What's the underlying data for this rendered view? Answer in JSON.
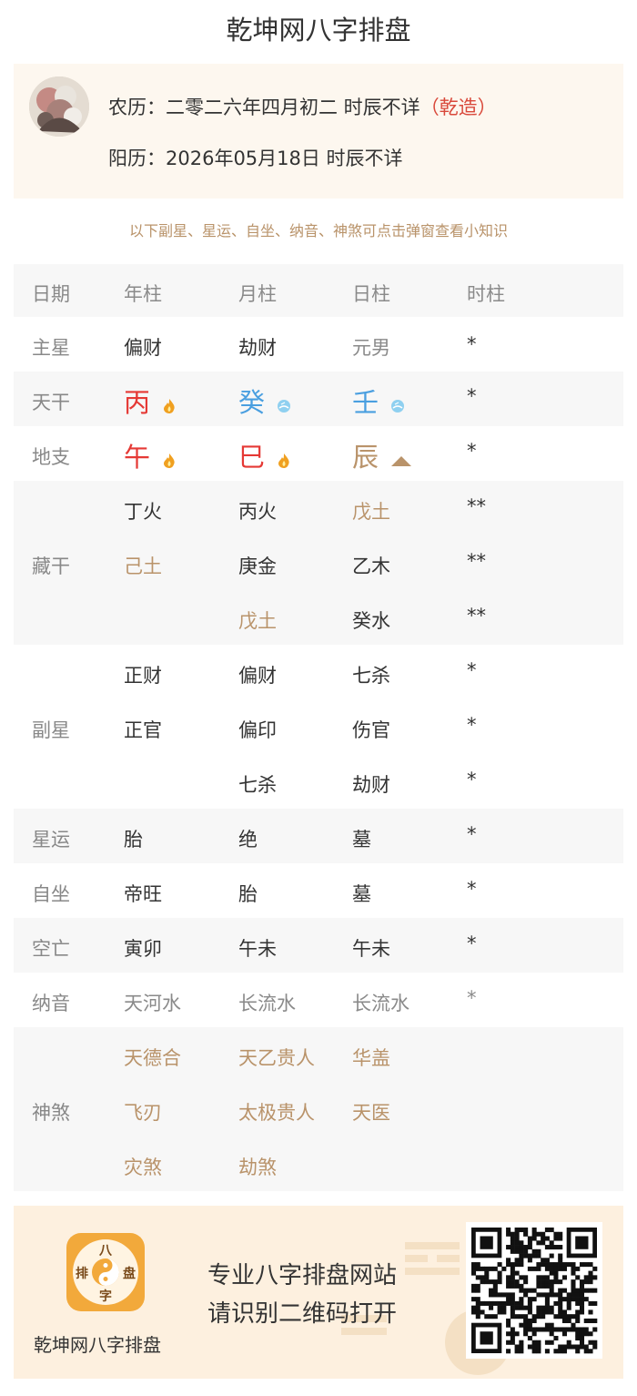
{
  "page": {
    "title": "乾坤网八字排盘"
  },
  "profile": {
    "lunar_prefix": "农历：二零二六年四月初二 时辰不详",
    "lunar_gender": "（乾造）",
    "solar": "阳历：2026年05月18日 时辰不详"
  },
  "notice": "以下副星、星运、自坐、纳音、神煞可点击弹窗查看小知识",
  "table": {
    "header": [
      "日期",
      "年柱",
      "月柱",
      "日柱",
      "时柱"
    ],
    "zhuxing": {
      "label": "主星",
      "values": [
        "偏财",
        "劫财",
        "元男",
        "*"
      ]
    },
    "tiangan": {
      "label": "天干",
      "values": [
        "丙",
        "癸",
        "壬",
        "*"
      ],
      "elements": [
        "fire-icon",
        "water-icon",
        "water-icon",
        ""
      ]
    },
    "dizhi": {
      "label": "地支",
      "values": [
        "午",
        "巳",
        "辰",
        "*"
      ],
      "elements": [
        "fire-icon",
        "fire-icon",
        "earth-icon",
        ""
      ]
    },
    "canggan": {
      "label": "藏干",
      "col1": [
        "丁火",
        "己土"
      ],
      "col2": [
        "丙火",
        "庚金",
        "戊土"
      ],
      "col3": [
        "戊土",
        "乙木",
        "癸水"
      ],
      "col4": [
        "**",
        "**",
        "**"
      ]
    },
    "fuxing": {
      "label": "副星",
      "col1": [
        "正财",
        "正官"
      ],
      "col2": [
        "偏财",
        "偏印",
        "七杀"
      ],
      "col3": [
        "七杀",
        "伤官",
        "劫财"
      ],
      "col4": [
        "*",
        "*",
        "*"
      ]
    },
    "xingyun": {
      "label": "星运",
      "values": [
        "胎",
        "绝",
        "墓",
        "*"
      ]
    },
    "zizuo": {
      "label": "自坐",
      "values": [
        "帝旺",
        "胎",
        "墓",
        "*"
      ]
    },
    "kongwang": {
      "label": "空亡",
      "values": [
        "寅卯",
        "午未",
        "午未",
        "*"
      ]
    },
    "nayin": {
      "label": "纳音",
      "values": [
        "天河水",
        "长流水",
        "长流水",
        "*"
      ]
    },
    "shensha": {
      "label": "神煞",
      "col1": [
        "天德合",
        "飞刃",
        "灾煞"
      ],
      "col2": [
        "天乙贵人",
        "太极贵人",
        "劫煞"
      ],
      "col3": [
        "华盖",
        "天医"
      ]
    }
  },
  "footer": {
    "logo_chars": [
      "八",
      "排",
      "盘",
      "字"
    ],
    "name": "乾坤网八字排盘",
    "slogan_line1": "专业八字排盘网站",
    "slogan_line2": "请识别二维码打开"
  },
  "colors": {
    "fire": "#e53935",
    "water": "#4a9fe0",
    "earth": "#b9936a",
    "accent_red": "#d9493b",
    "label_gray": "#888888"
  }
}
